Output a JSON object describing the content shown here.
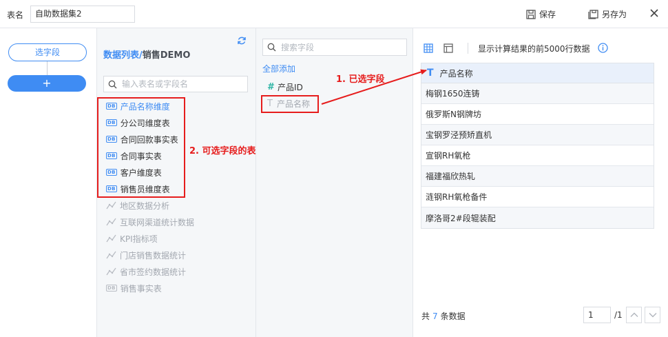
{
  "header": {
    "table_name_label": "表名",
    "table_name_value": "自助数据集2",
    "save_label": "保存",
    "save_as_label": "另存为"
  },
  "steps": {
    "select_field_label": "选字段",
    "add_label": "+"
  },
  "tables_panel": {
    "breadcrumb_prefix": "数据列表/",
    "breadcrumb_package": "销售DEMO",
    "search_placeholder": "输入表名或字段名",
    "items": [
      {
        "label": "产品名称维度",
        "type": "db",
        "state": "active"
      },
      {
        "label": "分公司维度表",
        "type": "db",
        "state": "normal"
      },
      {
        "label": "合同回款事实表",
        "type": "db",
        "state": "normal"
      },
      {
        "label": "合同事实表",
        "type": "db",
        "state": "normal"
      },
      {
        "label": "客户维度表",
        "type": "db",
        "state": "normal"
      },
      {
        "label": "销售员维度表",
        "type": "db",
        "state": "normal"
      },
      {
        "label": "地区数据分析",
        "type": "analysis",
        "state": "disabled"
      },
      {
        "label": "互联网渠道统计数据",
        "type": "analysis",
        "state": "disabled"
      },
      {
        "label": "KPI指标项",
        "type": "analysis",
        "state": "disabled"
      },
      {
        "label": "门店销售数据统计",
        "type": "analysis",
        "state": "disabled"
      },
      {
        "label": "省市签约数据统计",
        "type": "analysis",
        "state": "disabled"
      },
      {
        "label": "销售事实表",
        "type": "db",
        "state": "disabled"
      }
    ],
    "db_icon_text": "DB"
  },
  "fields_panel": {
    "search_placeholder": "搜索字段",
    "add_all_label": "全部添加",
    "fields": [
      {
        "label": "产品ID",
        "type": "number",
        "icon_text": "#"
      },
      {
        "label": "产品名称",
        "type": "text",
        "icon_text": "T"
      }
    ]
  },
  "preview": {
    "note": "显示计算结果的前5000行数据",
    "column_icon": "T",
    "column_header": "产品名称",
    "rows": [
      "梅钢1650连铸",
      "俄罗斯N钢牌坊",
      "宝钢罗泾预矫直机",
      "宣钢RH氧枪",
      "福建福欣热轧",
      "涟钢RH氧枪备件",
      "摩洛哥2#段辊装配"
    ],
    "count_prefix": "共",
    "count_value": "7",
    "count_suffix": "条数据",
    "page_current": "1",
    "page_total": "/1"
  },
  "annotations": {
    "tables_note": "2. 可选字段的表",
    "selected_note": "1. 已选字段"
  },
  "colors": {
    "accent": "#3f8cf3",
    "annotation_red": "#e61c1c",
    "number_field": "#2fb5a5"
  }
}
